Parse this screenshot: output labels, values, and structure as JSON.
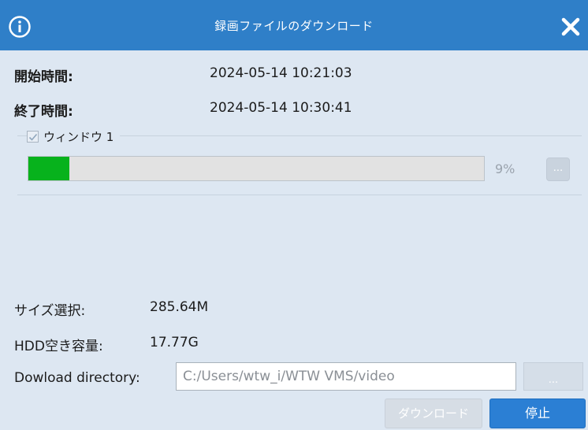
{
  "title": "録画ファイルのダウンロード",
  "icons": {
    "info": "info-icon",
    "close": "close-icon",
    "check": "check-icon"
  },
  "colors": {
    "titlebar": "#2f7fc8",
    "background": "#dde7f2",
    "progress_fill": "#07b21c",
    "primary_button": "#2b7fd4"
  },
  "info": {
    "start_label": "開始時間:",
    "start_value": "2024-05-14 10:21:03",
    "end_label": "終了時間:",
    "end_value": "2024-05-14 10:30:41"
  },
  "window": {
    "checkbox_label": "ウィンドウ 1",
    "checked": true,
    "progress": 0.09,
    "percent_text": "9%",
    "more_label": "..."
  },
  "stats": {
    "size_label": "サイズ選択:",
    "size_value": "285.64M",
    "hdd_label": "HDD空き容量:",
    "hdd_value": "17.77G"
  },
  "directory": {
    "label": "Dowload directory:",
    "value": "C:/Users/wtw_i/WTW VMS/video",
    "browse_label": "..."
  },
  "buttons": {
    "download": "ダウンロード",
    "stop": "停止"
  }
}
